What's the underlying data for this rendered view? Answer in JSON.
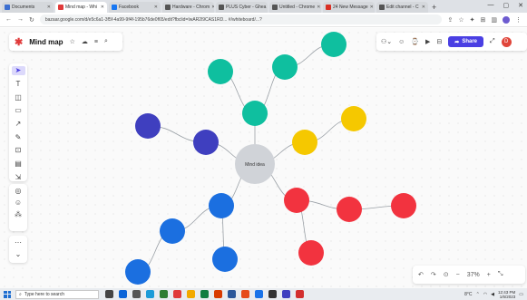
{
  "browser": {
    "tabs": [
      {
        "label": "Documents",
        "color": "#3c6fd1",
        "active": false
      },
      {
        "label": "Mind map - Whi",
        "color": "#e03a3a",
        "active": true
      },
      {
        "label": "Facebook",
        "color": "#1877f2",
        "active": false
      },
      {
        "label": "Hardware - Chrom",
        "color": "#555555",
        "active": false
      },
      {
        "label": "PLUS Cyber - Ghea",
        "color": "#555555",
        "active": false
      },
      {
        "label": "Untitled - Chrome",
        "color": "#555555",
        "active": false
      },
      {
        "label": "24 New Message",
        "color": "#d93025",
        "active": false
      },
      {
        "label": "Edit channel - C",
        "color": "#555555",
        "active": false
      }
    ],
    "new_tab": "+",
    "url": "bazaar.google.com/d/e5c6a1-3f5f-4a99-9f4f-195b76de0f65/edit?fbclid=IwAR2l9CAS1RD... #/whiteboard/...?"
  },
  "app": {
    "logo": "✱",
    "board_title": "Mind map",
    "share_label": "Share",
    "avatar_initial": "D",
    "zoom": "37%"
  },
  "mindmap": {
    "center_label": "Mind idea",
    "colors": {
      "teal": "#0fbf9f",
      "navy": "#3f3fbf",
      "yellow": "#f5c800",
      "red": "#f2333f",
      "blue": "#1b6fe0",
      "center": "#d0d3d8"
    }
  },
  "taskbar": {
    "search_placeholder": "Type here to search",
    "temperature": "8°C",
    "time": "12:43 PM",
    "date": "1/6/2023"
  }
}
